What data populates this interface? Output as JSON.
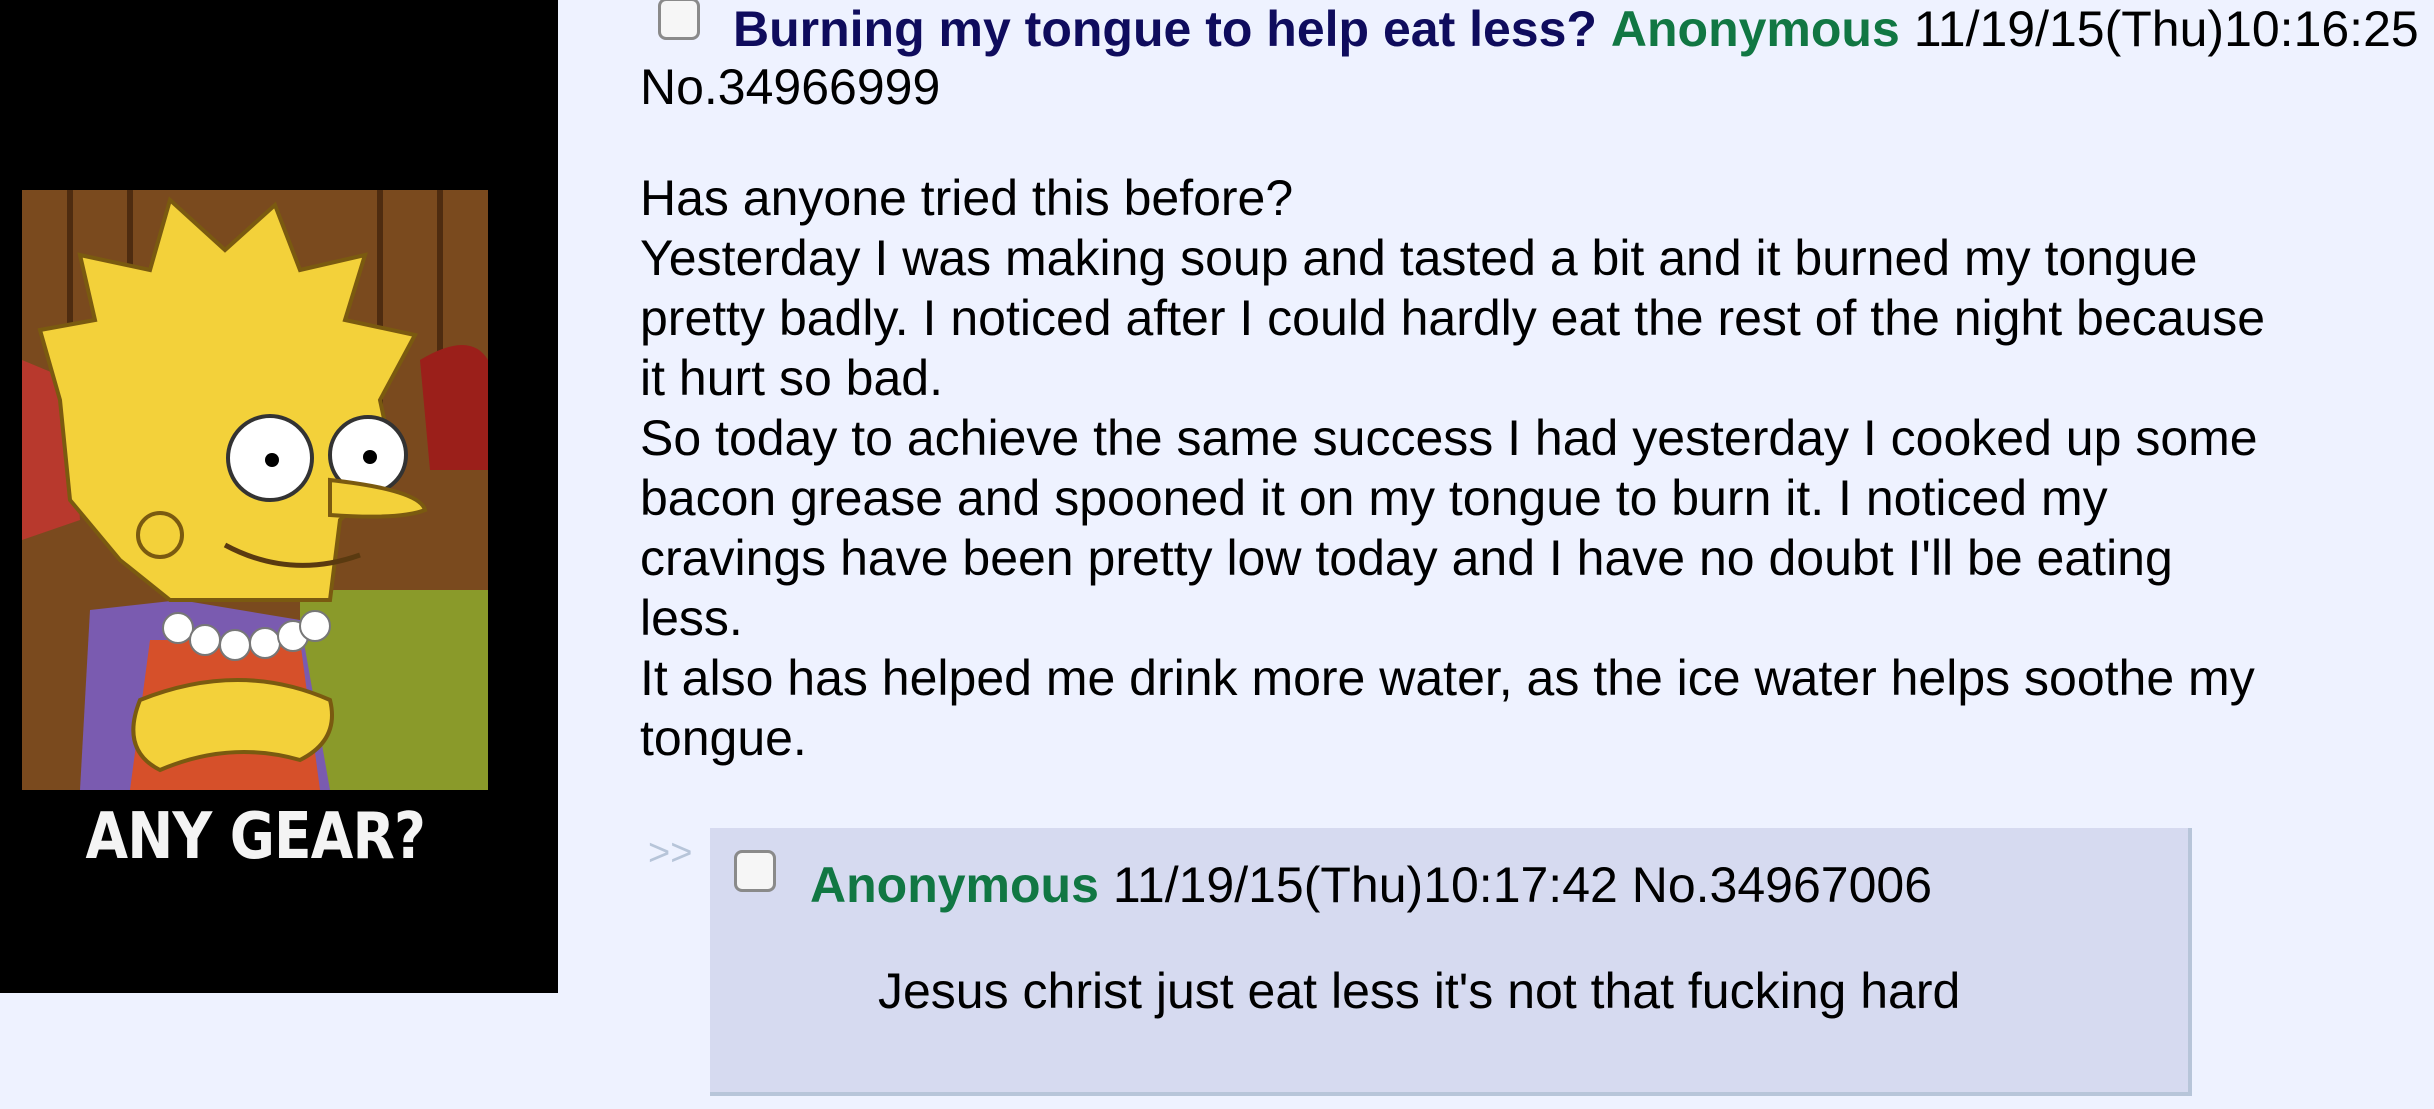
{
  "op": {
    "image": {
      "caption": "ANY GEAR?"
    },
    "subject": "Burning my tongue to help eat less?",
    "name": "Anonymous",
    "datetime": "11/19/15(Thu)10:16:25",
    "post_number": "No.34966999",
    "body": [
      "Has anyone tried this before?",
      "Yesterday I was making soup and tasted a bit and it burned my tongue pretty badly. I noticed after I could hardly eat the rest of the night because it hurt so bad.",
      "So today to achieve the same success I had yesterday I cooked up some bacon grease and spooned it on my tongue to burn it. I noticed my cravings have been pretty low today and I have no doubt I'll be eating less.",
      "It also has helped me drink more water, as the ice water helps soothe my tongue."
    ]
  },
  "reply": {
    "arrows": ">>",
    "name": "Anonymous",
    "datetime": "11/19/15(Thu)10:17:42",
    "post_number": "No.34967006",
    "body": "Jesus christ just eat less it's not that fucking hard"
  },
  "colors": {
    "page_background": "#eef2ff",
    "subject": "#0f0c5d",
    "name": "#117743",
    "reply_background": "#d6daf0",
    "reply_border": "#b7c5d9"
  }
}
